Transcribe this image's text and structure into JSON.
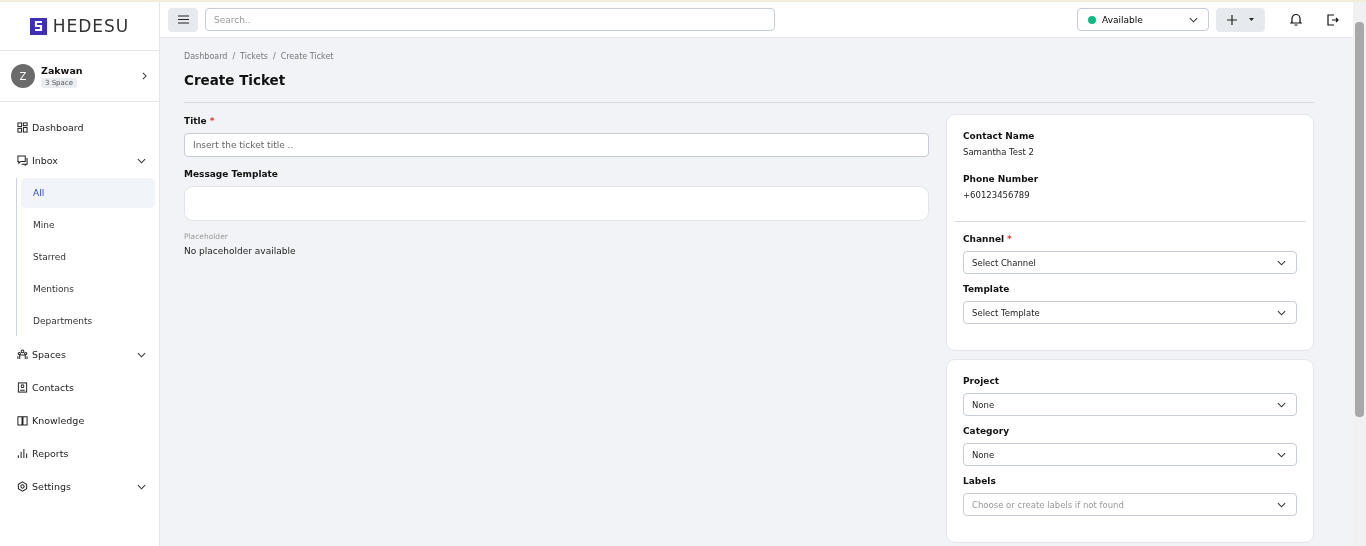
{
  "logo": {
    "text": "HEDESU"
  },
  "user": {
    "initial": "Z",
    "name": "Zakwan",
    "badge": "3 Space"
  },
  "nav": [
    {
      "label": "Dashboard",
      "expandable": false
    },
    {
      "label": "Inbox",
      "expandable": true,
      "children": [
        {
          "label": "All",
          "selected": true
        },
        {
          "label": "Mine",
          "selected": false
        },
        {
          "label": "Starred",
          "selected": false
        },
        {
          "label": "Mentions",
          "selected": false
        },
        {
          "label": "Departments",
          "selected": false
        }
      ]
    },
    {
      "label": "Spaces",
      "expandable": true
    },
    {
      "label": "Contacts",
      "expandable": false
    },
    {
      "label": "Knowledge",
      "expandable": false
    },
    {
      "label": "Reports",
      "expandable": false
    },
    {
      "label": "Settings",
      "expandable": true
    }
  ],
  "topbar": {
    "search": {
      "placeholder": "Search.."
    },
    "status": {
      "label": "Available",
      "color": "#10b981"
    }
  },
  "breadcrumb": {
    "separator": "/",
    "items": [
      "Dashboard",
      "Tickets",
      "Create Ticket"
    ]
  },
  "required_mark": "*",
  "page_title": "Create Ticket",
  "form": {
    "title": {
      "label": "Title",
      "required": true,
      "placeholder": "Insert the ticket title .."
    },
    "message_template": {
      "label": "Message Template"
    },
    "placeholder_info": {
      "label": "Placeholder",
      "value": "No placeholder available"
    }
  },
  "contact": [
    {
      "label": "Contact Name",
      "value": "Samantha Test 2"
    },
    {
      "label": "Phone Number",
      "value": "+60123456789"
    }
  ],
  "channel_fields": [
    {
      "label": "Channel",
      "required": true,
      "value": "Select Channel"
    },
    {
      "label": "Template",
      "required": false,
      "value": "Select Template"
    }
  ],
  "details_fields": [
    {
      "label": "Project",
      "required": false,
      "value": "None"
    },
    {
      "label": "Category",
      "required": false,
      "value": "None"
    },
    {
      "label": "Labels",
      "required": false,
      "placeholder": "Choose or create labels if not found"
    }
  ]
}
